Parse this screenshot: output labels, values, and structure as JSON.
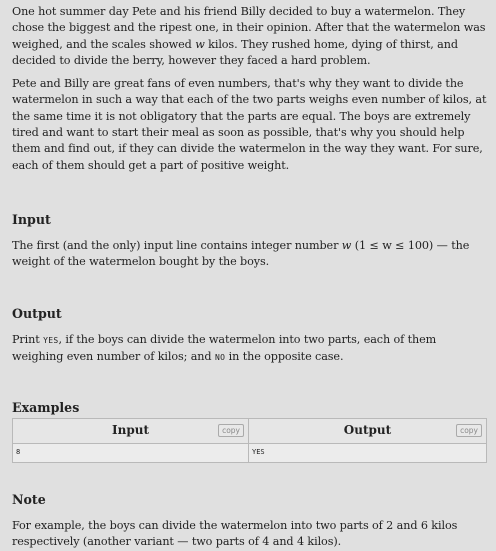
{
  "statement": {
    "para1": "One hot summer day Pete and his friend Billy decided to buy a watermelon. They chose the biggest and the ripest one, in their opinion. After that the watermelon was weighed, and the scales showed",
    "para1_var": "w",
    "para1_end": "kilos. They rushed home, dying of thirst, and decided to divide the berry, however they faced a hard problem.",
    "para2": "Pete and Billy are great fans of even numbers, that's why they want to divide the watermelon in such a way that each of the two parts weighs even number of kilos, at the same time it is not obligatory that the parts are equal. The boys are extremely tired and want to start their meal as soon as possible, that's why you should help them and find out, if they can divide the watermelon in the way they want. For sure, each of them should get a part of positive weight."
  },
  "input_section": {
    "title": "Input",
    "text_start": "The first (and the only) input line contains integer number",
    "var": "w",
    "range": "(1 ≤ w ≤ 100)",
    "text_end": "— the weight of the watermelon bought by the boys."
  },
  "output_section": {
    "title": "Output",
    "text_start": "Print",
    "yes": "YES",
    "text_mid": ", if the boys can divide the watermelon into two parts, each of them weighing even number of kilos; and",
    "no": "NO",
    "text_end": "in the opposite case."
  },
  "examples": {
    "title": "Examples",
    "input_header": "Input",
    "output_header": "Output",
    "copy_label": "copy",
    "input_value": "8",
    "output_value": "YES"
  },
  "note_section": {
    "title": "Note",
    "text": "For example, the boys can divide the watermelon into two parts of 2 and 6 kilos respectively (another variant — two parts of 4 and 4 kilos)."
  }
}
